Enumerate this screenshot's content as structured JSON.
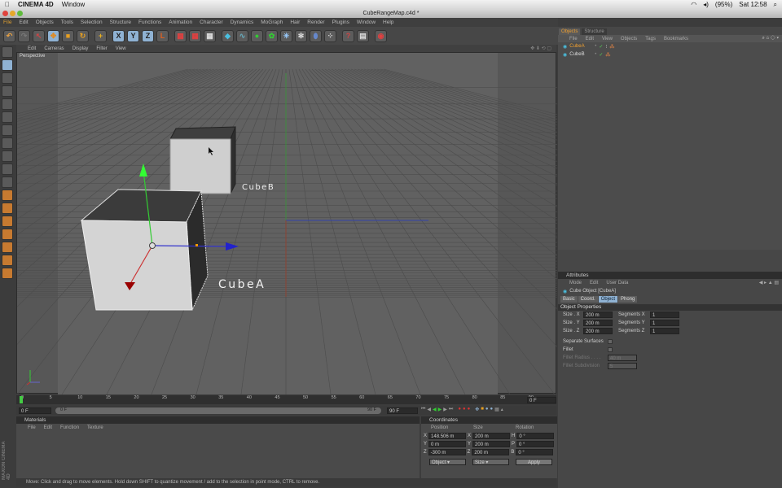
{
  "macbar": {
    "app": "CINEMA 4D",
    "menu": "Window",
    "battery": "(95%)",
    "clock": "Sat 12:58"
  },
  "window": {
    "title": "CubeRangeMap.c4d *"
  },
  "menus": [
    "File",
    "Edit",
    "Objects",
    "Tools",
    "Selection",
    "Structure",
    "Functions",
    "Animation",
    "Character",
    "Dynamics",
    "MoGraph",
    "Hair",
    "Render",
    "Plugins",
    "Window",
    "Help"
  ],
  "viewport": {
    "menu": [
      "Edit",
      "Cameras",
      "Display",
      "Filter",
      "View"
    ],
    "label": "Perspective",
    "cube_labels": {
      "a": "CubeA",
      "b": "CubeB"
    }
  },
  "objects": {
    "tabs": [
      "Objects",
      "Structure"
    ],
    "menu": [
      "File",
      "Edit",
      "View",
      "Objects",
      "Tags",
      "Bookmarks"
    ],
    "items": [
      {
        "name": "CubeA",
        "selected": true
      },
      {
        "name": "CubeB",
        "selected": false
      }
    ]
  },
  "attributes": {
    "title": "Attributes",
    "menu": [
      "Mode",
      "Edit",
      "User Data"
    ],
    "object": "Cube Object [CubeA]",
    "tabs": [
      "Basic",
      "Coord.",
      "Object",
      "Phong"
    ],
    "active_tab": "Object",
    "section": "Object Properties",
    "size": [
      {
        "label": "Size . X",
        "value": "200 m"
      },
      {
        "label": "Size . Y",
        "value": "200 m"
      },
      {
        "label": "Size . Z",
        "value": "200 m"
      }
    ],
    "segments": [
      {
        "label": "Segments X",
        "value": "1"
      },
      {
        "label": "Segments Y",
        "value": "1"
      },
      {
        "label": "Segments Z",
        "value": "1"
      }
    ],
    "separate_surfaces": "Separate Surfaces",
    "fillet": "Fillet",
    "fillet_radius": {
      "label": "Fillet Radius . . . .",
      "value": "40 m"
    },
    "fillet_subdivision": {
      "label": "Fillet Subdivision",
      "value": "5"
    }
  },
  "timeline": {
    "ticks": [
      "0",
      "5",
      "10",
      "15",
      "20",
      "25",
      "30",
      "35",
      "40",
      "45",
      "50",
      "55",
      "60",
      "65",
      "70",
      "75",
      "80",
      "85",
      "90"
    ],
    "current": "0 F",
    "start": "0 F",
    "range_start": "0 F",
    "range_end": "90 F",
    "end": "90 F"
  },
  "materials": {
    "title": "Materials",
    "menu": [
      "File",
      "Edit",
      "Function",
      "Texture"
    ]
  },
  "coordinates": {
    "title": "Coordinates",
    "headers": [
      "Position",
      "Size",
      "Rotation"
    ],
    "rows": [
      {
        "axis": "X",
        "pos": "148.506 m",
        "saxis": "X",
        "size": "200 m",
        "raxis": "H",
        "rot": "0 °"
      },
      {
        "axis": "Y",
        "pos": "0 m",
        "saxis": "Y",
        "size": "200 m",
        "raxis": "P",
        "rot": "0 °"
      },
      {
        "axis": "Z",
        "pos": "-300 m",
        "saxis": "Z",
        "size": "200 m",
        "raxis": "B",
        "rot": "0 °"
      }
    ],
    "mode": "Object",
    "size_mode": "Size",
    "apply": "Apply"
  },
  "status": "Move: Click and drag to move elements. Hold down SHIFT to quantize movement / add to the selection in point mode, CTRL to remove.",
  "branding": "MAXON CINEMA 4D"
}
